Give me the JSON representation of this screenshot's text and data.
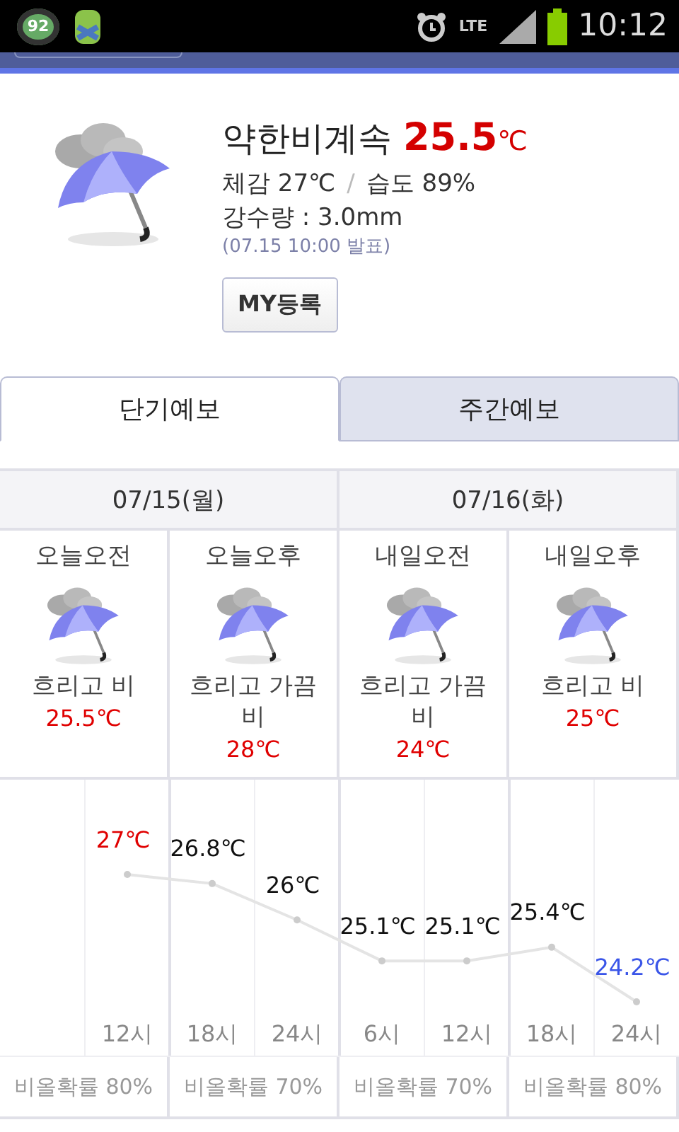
{
  "status_bar": {
    "notification_badge": "92",
    "network": "LTE",
    "time": "10:12"
  },
  "current": {
    "condition": "약한비계속",
    "temperature": "25.5",
    "unit": "℃",
    "feels_like": "체감 27℃",
    "separator": "/",
    "humidity": "습도 89%",
    "precipitation": "강수량 : 3.0mm",
    "issued": "(07.15 10:00 발표)",
    "button": "MY등록"
  },
  "tabs": [
    {
      "label": "단기예보",
      "selected": true
    },
    {
      "label": "주간예보",
      "selected": false
    }
  ],
  "days": [
    {
      "date": "07/15(월)",
      "periods": [
        {
          "name": "오늘오전",
          "condition": "흐리고 비",
          "temperature": "25.5℃"
        },
        {
          "name": "오늘오후",
          "condition": "흐리고 가끔 비",
          "temperature": "28℃"
        }
      ]
    },
    {
      "date": "07/16(화)",
      "periods": [
        {
          "name": "내일오전",
          "condition": "흐리고 가끔 비",
          "temperature": "24℃"
        },
        {
          "name": "내일오후",
          "condition": "흐리고 비",
          "temperature": "25℃"
        }
      ]
    }
  ],
  "hourly": {
    "chart_data": {
      "type": "line",
      "categories": [
        "12시",
        "18시",
        "24시",
        "6시",
        "12시",
        "18시",
        "24시"
      ],
      "values": [
        27,
        26.8,
        26,
        25.1,
        25.1,
        25.4,
        24.2
      ],
      "value_labels": [
        "27℃",
        "26.8℃",
        "26℃",
        "25.1℃",
        "25.1℃",
        "25.4℃",
        "24.2℃"
      ],
      "marker": true
    }
  },
  "rain_chance": [
    "비올확률 80%",
    "비올확률 70%",
    "비올확률 70%",
    "비올확률 80%"
  ]
}
